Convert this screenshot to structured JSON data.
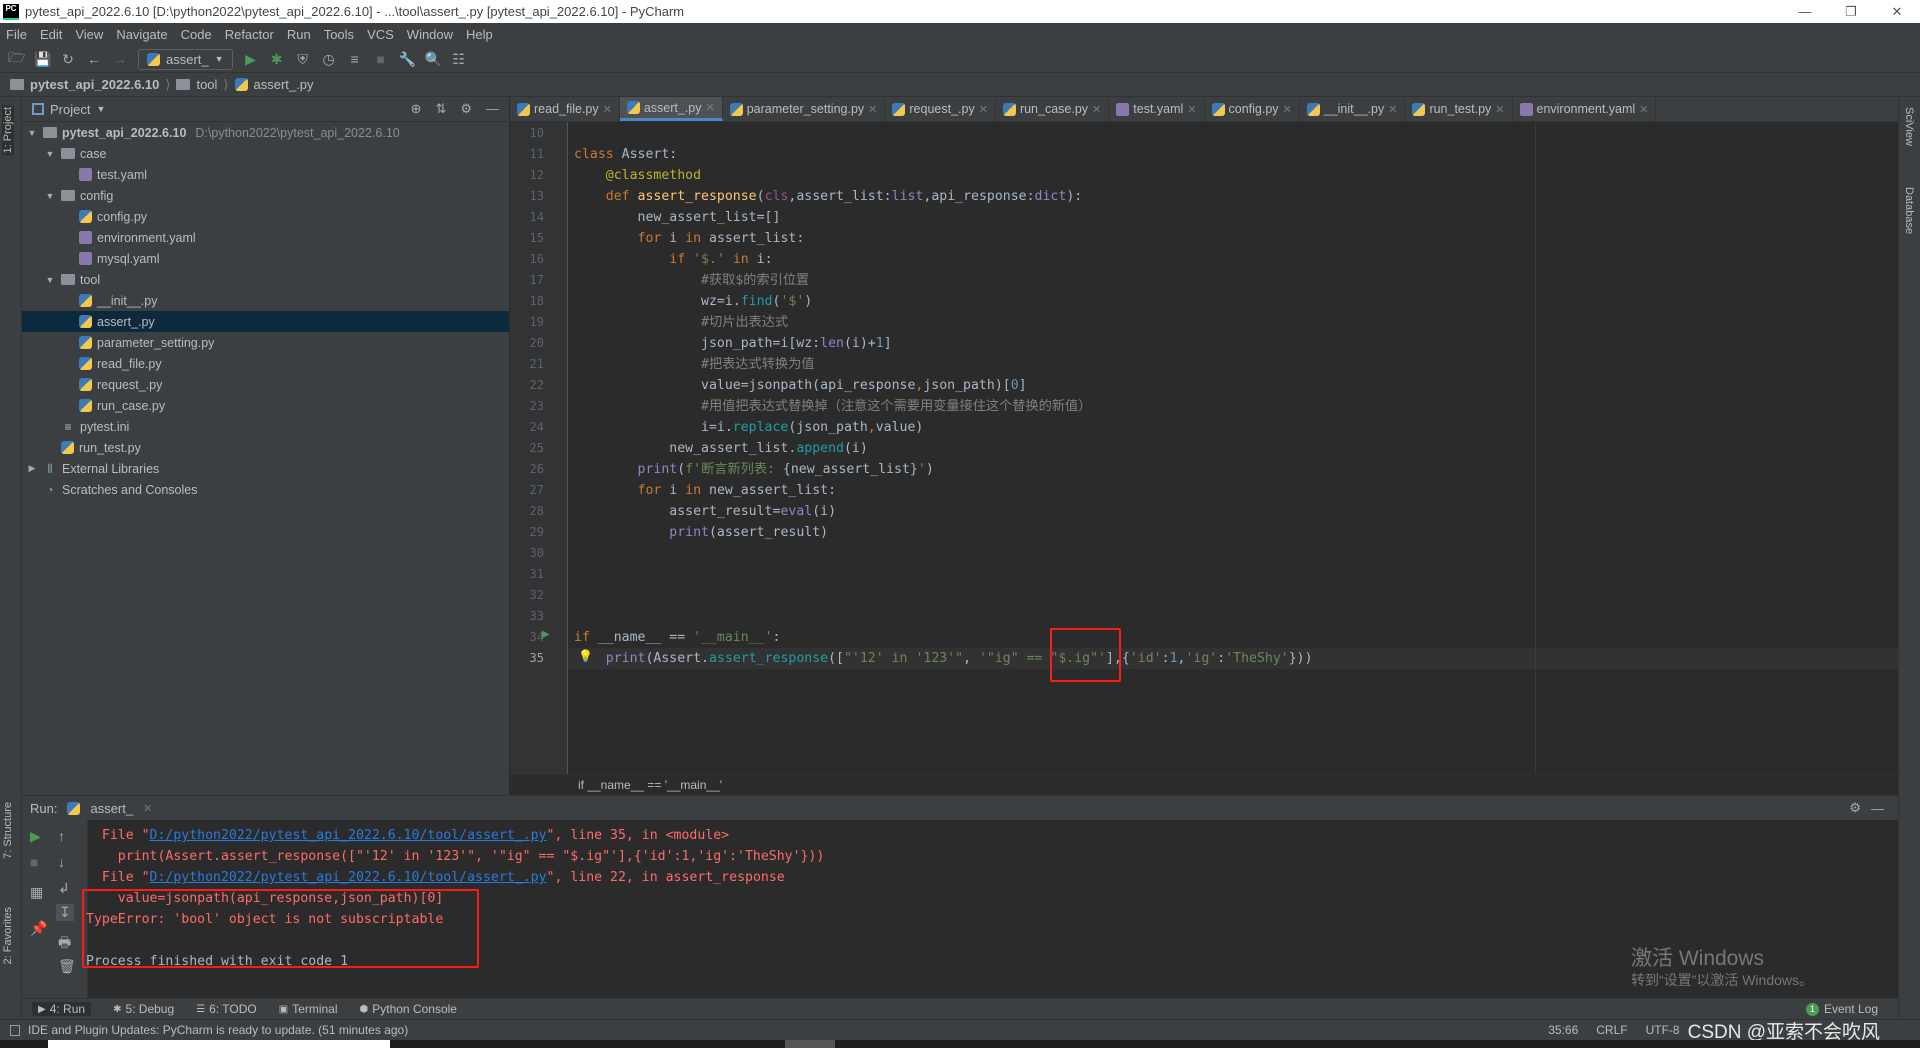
{
  "window": {
    "title": "pytest_api_2022.6.10 [D:\\python2022\\pytest_api_2022.6.10] - ...\\tool\\assert_.py [pytest_api_2022.6.10] - PyCharm",
    "logo": "PC"
  },
  "menu": [
    "File",
    "Edit",
    "View",
    "Navigate",
    "Code",
    "Refactor",
    "Run",
    "Tools",
    "VCS",
    "Window",
    "Help"
  ],
  "toolbar": {
    "run_config": "assert_"
  },
  "breadcrumb": [
    "pytest_api_2022.6.10",
    "tool",
    "assert_.py"
  ],
  "left_strip": {
    "project": "1: Project",
    "structure": "7: Structure",
    "favorites": "2: Favorites"
  },
  "right_strip": {
    "sciview": "SciView",
    "database": "Database"
  },
  "project": {
    "title": "Project",
    "tree": [
      {
        "label": "pytest_api_2022.6.10",
        "path": "D:\\python2022\\pytest_api_2022.6.10",
        "type": "folder",
        "depth": 0,
        "expanded": true,
        "bold": true
      },
      {
        "label": "case",
        "type": "folder",
        "depth": 1,
        "expanded": true
      },
      {
        "label": "test.yaml",
        "type": "yaml",
        "depth": 2
      },
      {
        "label": "config",
        "type": "folder",
        "depth": 1,
        "expanded": true
      },
      {
        "label": "config.py",
        "type": "py",
        "depth": 2
      },
      {
        "label": "environment.yaml",
        "type": "yaml",
        "depth": 2
      },
      {
        "label": "mysql.yaml",
        "type": "yaml",
        "depth": 2
      },
      {
        "label": "tool",
        "type": "folder",
        "depth": 1,
        "expanded": true
      },
      {
        "label": "__init__.py",
        "type": "py",
        "depth": 2
      },
      {
        "label": "assert_.py",
        "type": "py",
        "depth": 2,
        "selected": true
      },
      {
        "label": "parameter_setting.py",
        "type": "py",
        "depth": 2
      },
      {
        "label": "read_file.py",
        "type": "py",
        "depth": 2
      },
      {
        "label": "request_.py",
        "type": "py",
        "depth": 2
      },
      {
        "label": "run_case.py",
        "type": "py",
        "depth": 2
      },
      {
        "label": "pytest.ini",
        "type": "ini",
        "depth": 1
      },
      {
        "label": "run_test.py",
        "type": "py",
        "depth": 1
      },
      {
        "label": "External Libraries",
        "type": "lib",
        "depth": 0,
        "expanded": false
      },
      {
        "label": "Scratches and Consoles",
        "type": "scratch",
        "depth": 0
      }
    ]
  },
  "tabs": [
    {
      "label": "read_file.py",
      "type": "py"
    },
    {
      "label": "assert_.py",
      "type": "py",
      "active": true
    },
    {
      "label": "parameter_setting.py",
      "type": "py"
    },
    {
      "label": "request_.py",
      "type": "py"
    },
    {
      "label": "run_case.py",
      "type": "py"
    },
    {
      "label": "test.yaml",
      "type": "yaml"
    },
    {
      "label": "config.py",
      "type": "py"
    },
    {
      "label": "__init__.py",
      "type": "py"
    },
    {
      "label": "run_test.py",
      "type": "py"
    },
    {
      "label": "environment.yaml",
      "type": "yaml"
    }
  ],
  "editor": {
    "current_line": 35,
    "lines": [
      {
        "n": 10,
        "t": []
      },
      {
        "n": 11,
        "t": [
          [
            "class ",
            "kw"
          ],
          [
            "Assert:",
            ""
          ]
        ]
      },
      {
        "n": 12,
        "t": [
          [
            "    ",
            ""
          ],
          [
            "@classmethod",
            "dec"
          ]
        ]
      },
      {
        "n": 13,
        "t": [
          [
            "    ",
            ""
          ],
          [
            "def ",
            "kw"
          ],
          [
            "assert_response",
            "fn"
          ],
          [
            "(",
            ""
          ],
          [
            "cls",
            "self"
          ],
          [
            ",assert_list:",
            ""
          ],
          [
            "list",
            "bi"
          ],
          [
            ",api_response:",
            ""
          ],
          [
            "dict",
            "bi"
          ],
          [
            "):",
            ""
          ]
        ]
      },
      {
        "n": 14,
        "t": [
          [
            "        new_assert_list=[]",
            ""
          ]
        ]
      },
      {
        "n": 15,
        "t": [
          [
            "        ",
            ""
          ],
          [
            "for ",
            "kw"
          ],
          [
            "i ",
            ""
          ],
          [
            "in ",
            "kw"
          ],
          [
            "assert_list:",
            ""
          ]
        ]
      },
      {
        "n": 16,
        "t": [
          [
            "            ",
            ""
          ],
          [
            "if ",
            "kw"
          ],
          [
            "'$.'",
            "str"
          ],
          [
            " ",
            ""
          ],
          [
            "in ",
            "kw"
          ],
          [
            "i:",
            ""
          ]
        ]
      },
      {
        "n": 17,
        "t": [
          [
            "                ",
            ""
          ],
          [
            "#获取$的索引位置",
            "cm"
          ]
        ]
      },
      {
        "n": 18,
        "t": [
          [
            "                wz=i.",
            ""
          ],
          [
            "find",
            "meth"
          ],
          [
            "(",
            ""
          ],
          [
            "'$'",
            "str"
          ],
          [
            ")",
            ""
          ]
        ]
      },
      {
        "n": 19,
        "t": [
          [
            "                ",
            ""
          ],
          [
            "#切片出表达式",
            "cm"
          ]
        ]
      },
      {
        "n": 20,
        "t": [
          [
            "                json_path=i[wz:",
            ""
          ],
          [
            "len",
            "bi"
          ],
          [
            "(i)+",
            ""
          ],
          [
            "1",
            "num"
          ],
          [
            "]",
            ""
          ]
        ]
      },
      {
        "n": 21,
        "t": [
          [
            "                ",
            ""
          ],
          [
            "#把表达式转换为值",
            "cm"
          ]
        ]
      },
      {
        "n": 22,
        "t": [
          [
            "                value=jsonpath(api_response",
            ""
          ],
          [
            ",",
            "kw"
          ],
          [
            "json_path)[",
            ""
          ],
          [
            "0",
            "num"
          ],
          [
            "]",
            ""
          ]
        ]
      },
      {
        "n": 23,
        "t": [
          [
            "                ",
            ""
          ],
          [
            "#用值把表达式替换掉（注意这个需要用变量接住这个替换的新值）",
            "cm"
          ]
        ]
      },
      {
        "n": 24,
        "t": [
          [
            "                i=i.",
            ""
          ],
          [
            "replace",
            "meth"
          ],
          [
            "(json_path",
            ""
          ],
          [
            ",",
            "kw"
          ],
          [
            "value)",
            ""
          ]
        ]
      },
      {
        "n": 25,
        "t": [
          [
            "            new_assert_list.",
            ""
          ],
          [
            "append",
            "meth"
          ],
          [
            "(i)",
            ""
          ]
        ]
      },
      {
        "n": 26,
        "t": [
          [
            "        ",
            ""
          ],
          [
            "print",
            "bi"
          ],
          [
            "(",
            ""
          ],
          [
            "f'断言新列表: ",
            "str"
          ],
          [
            "{new_assert_list}",
            ""
          ],
          [
            "'",
            "str"
          ],
          [
            ")",
            ""
          ]
        ]
      },
      {
        "n": 27,
        "t": [
          [
            "        ",
            ""
          ],
          [
            "for ",
            "kw"
          ],
          [
            "i ",
            ""
          ],
          [
            "in ",
            "kw"
          ],
          [
            "new_assert_list:",
            ""
          ]
        ]
      },
      {
        "n": 28,
        "t": [
          [
            "            assert_result=",
            ""
          ],
          [
            "eval",
            "bi"
          ],
          [
            "(i)",
            ""
          ]
        ]
      },
      {
        "n": 29,
        "t": [
          [
            "            ",
            ""
          ],
          [
            "print",
            "bi"
          ],
          [
            "(assert_result)",
            ""
          ]
        ]
      },
      {
        "n": 30,
        "t": []
      },
      {
        "n": 31,
        "t": []
      },
      {
        "n": 32,
        "t": []
      },
      {
        "n": 33,
        "t": []
      },
      {
        "n": 34,
        "t": [
          [
            "if ",
            "kw"
          ],
          [
            "__name__ == ",
            ""
          ],
          [
            "'__main__'",
            "str"
          ],
          [
            ":",
            ""
          ]
        ]
      },
      {
        "n": 35,
        "t": [
          [
            "    ",
            ""
          ],
          [
            "print",
            "bi"
          ],
          [
            "(Assert.",
            ""
          ],
          [
            "assert_response",
            "meth"
          ],
          [
            "([",
            ""
          ],
          [
            "\"'12' in '123'\"",
            "str"
          ],
          [
            ", ",
            ""
          ],
          [
            "'\"ig\" == \"$.ig\"'",
            "str"
          ],
          [
            "],{",
            ""
          ],
          [
            "'id'",
            "str"
          ],
          [
            ":",
            ""
          ],
          [
            "1",
            "num"
          ],
          [
            ",",
            ""
          ],
          [
            "'ig'",
            "str"
          ],
          [
            ":",
            ""
          ],
          [
            "'TheShy'",
            "str"
          ],
          [
            "}))",
            ""
          ]
        ]
      }
    ],
    "breadcrumb": "if __name__ == '__main__'"
  },
  "run": {
    "label": "Run:",
    "tab": "assert_",
    "output": [
      {
        "pre": "  File \"",
        "link": "D:/python2022/pytest_api_2022.6.10/tool/assert_.py",
        "post": "\", line 35, in <module>"
      },
      {
        "text": "    print(Assert.assert_response([\"'12' in '123'\", '\"ig\" == \"$.ig\"'],{'id':1,'ig':'TheShy'}))"
      },
      {
        "pre": "  File \"",
        "link": "D:/python2022/pytest_api_2022.6.10/tool/assert_.py",
        "post": "\", line 22, in assert_response"
      },
      {
        "text": "    value=jsonpath(api_response,json_path)[0]"
      },
      {
        "text": "TypeError: 'bool' object is not subscriptable"
      },
      {
        "text": ""
      },
      {
        "text": "Process finished with exit code 1",
        "normal": true
      }
    ]
  },
  "tool_windows": [
    {
      "label": "4: Run",
      "icon": "run-icon"
    },
    {
      "label": "5: Debug",
      "icon": "bug-icon"
    },
    {
      "label": "6: TODO",
      "icon": "list-icon"
    },
    {
      "label": "Terminal",
      "icon": "terminal-icon"
    },
    {
      "label": "Python Console",
      "icon": "python-icon"
    }
  ],
  "event_log": {
    "label": "Event Log",
    "count": "1"
  },
  "status": {
    "message": "IDE and Plugin Updates: PyCharm is ready to update. (51 minutes ago)",
    "position": "35:66",
    "line_sep": "CRLF",
    "encoding": "UTF-8"
  },
  "overlay": {
    "activate_title": "激活 Windows",
    "activate_sub": "转到“设置”以激活 Windows。",
    "csdn": "CSDN @亚索不会吹风"
  },
  "colors": {
    "accent": "#4a88c7",
    "error": "#ff6b68",
    "link": "#287bde",
    "highlight_box": "#ff1a1a",
    "selection": "#0d293e"
  }
}
